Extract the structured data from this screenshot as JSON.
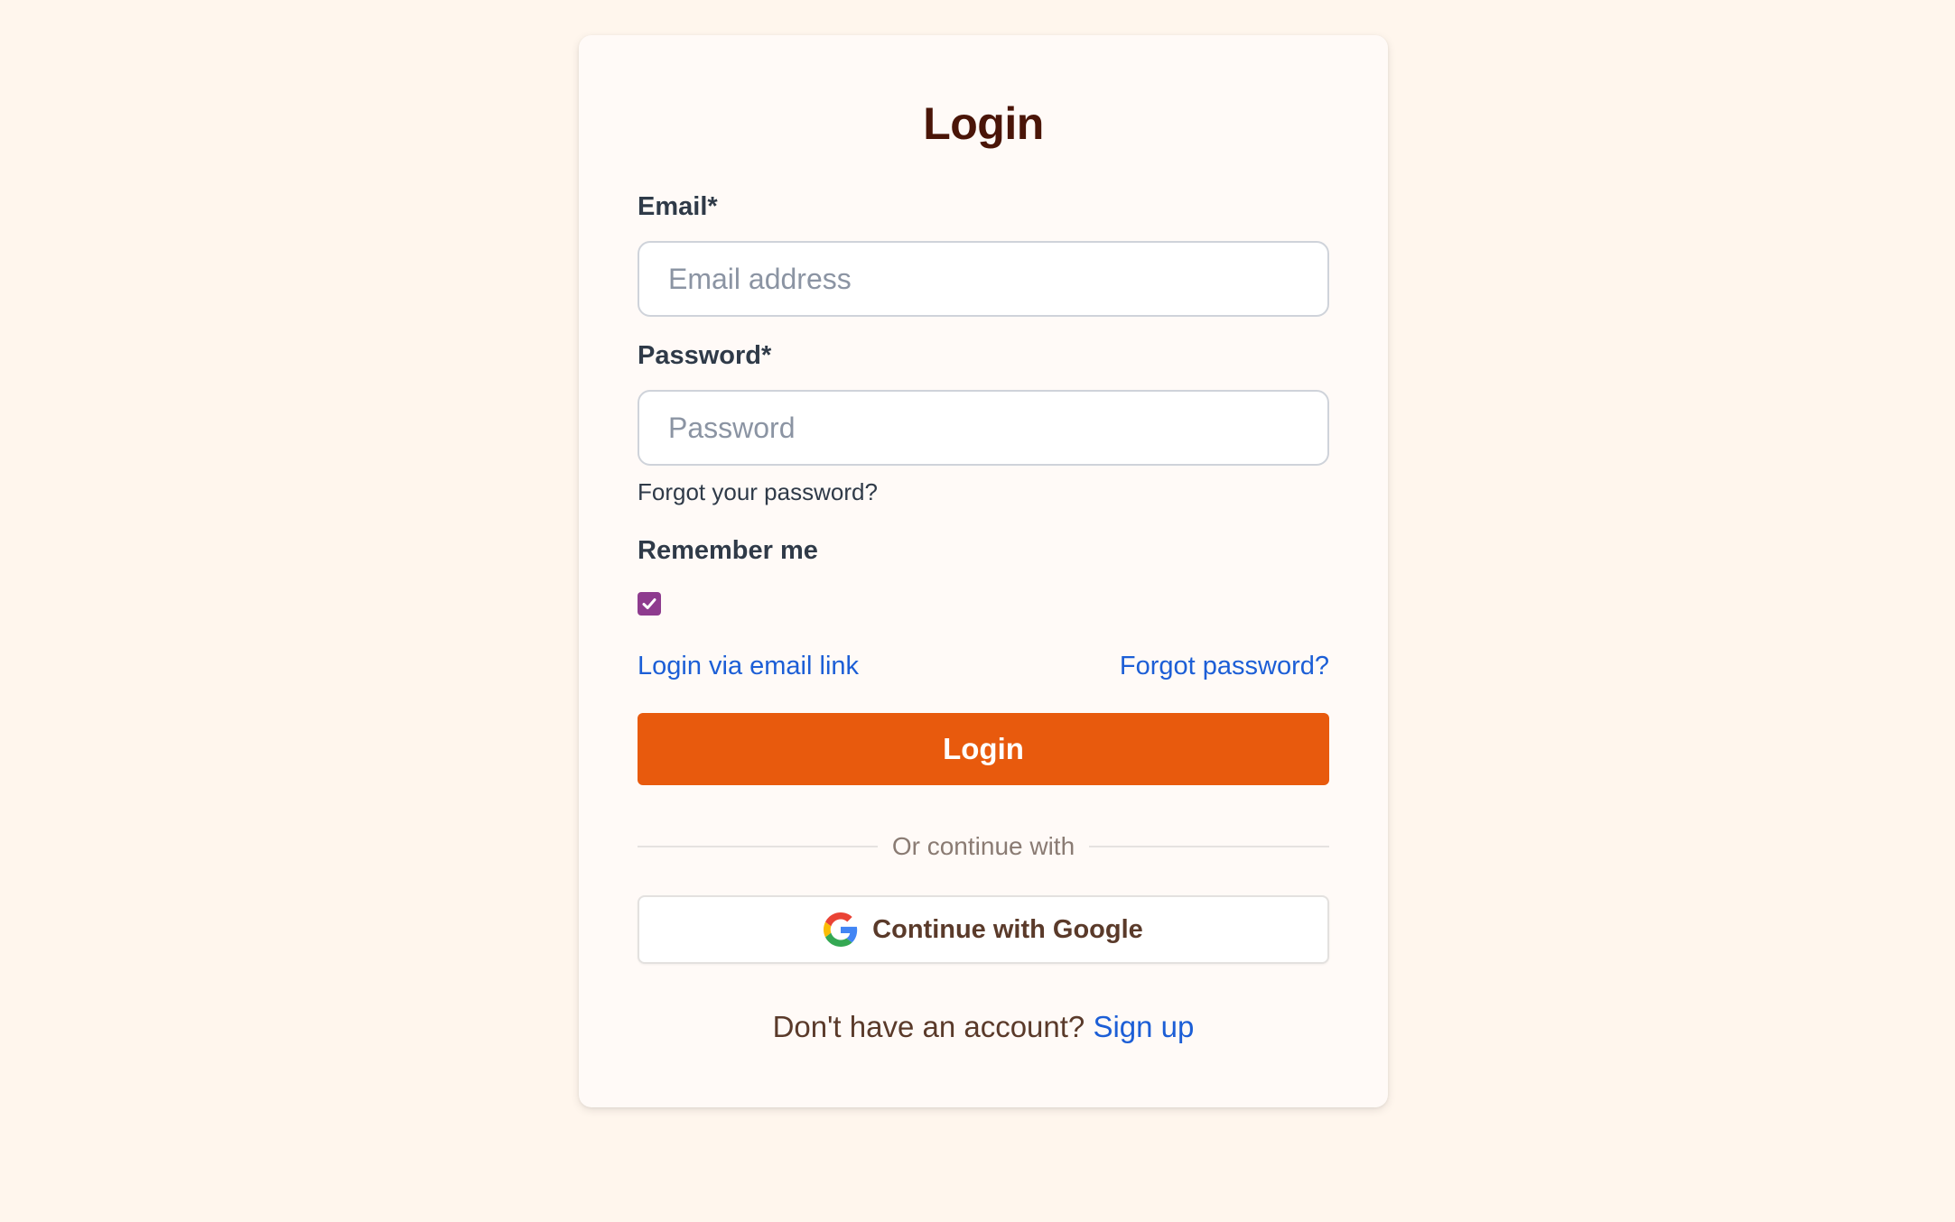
{
  "login": {
    "title": "Login",
    "email_label": "Email*",
    "email_placeholder": "Email address",
    "password_label": "Password*",
    "password_placeholder": "Password",
    "forgot_your_password": "Forgot your password?",
    "remember_label": "Remember me",
    "remember_checked": true,
    "email_link_label": "Login via email link",
    "forgot_password_link": "Forgot password?",
    "submit_label": "Login",
    "divider_text": "Or continue with",
    "google_label": "Continue with Google",
    "google_icon": "google-g-icon",
    "signup_prompt": "Don't have an account?",
    "signup_link": "Sign up"
  },
  "colors": {
    "page_background": "#fff6ed",
    "card_background": "#fffaf7",
    "title": "#4a1508",
    "primary_button": "#e85a0d",
    "link": "#1c5ed6",
    "checkbox": "#8e3b8e"
  }
}
